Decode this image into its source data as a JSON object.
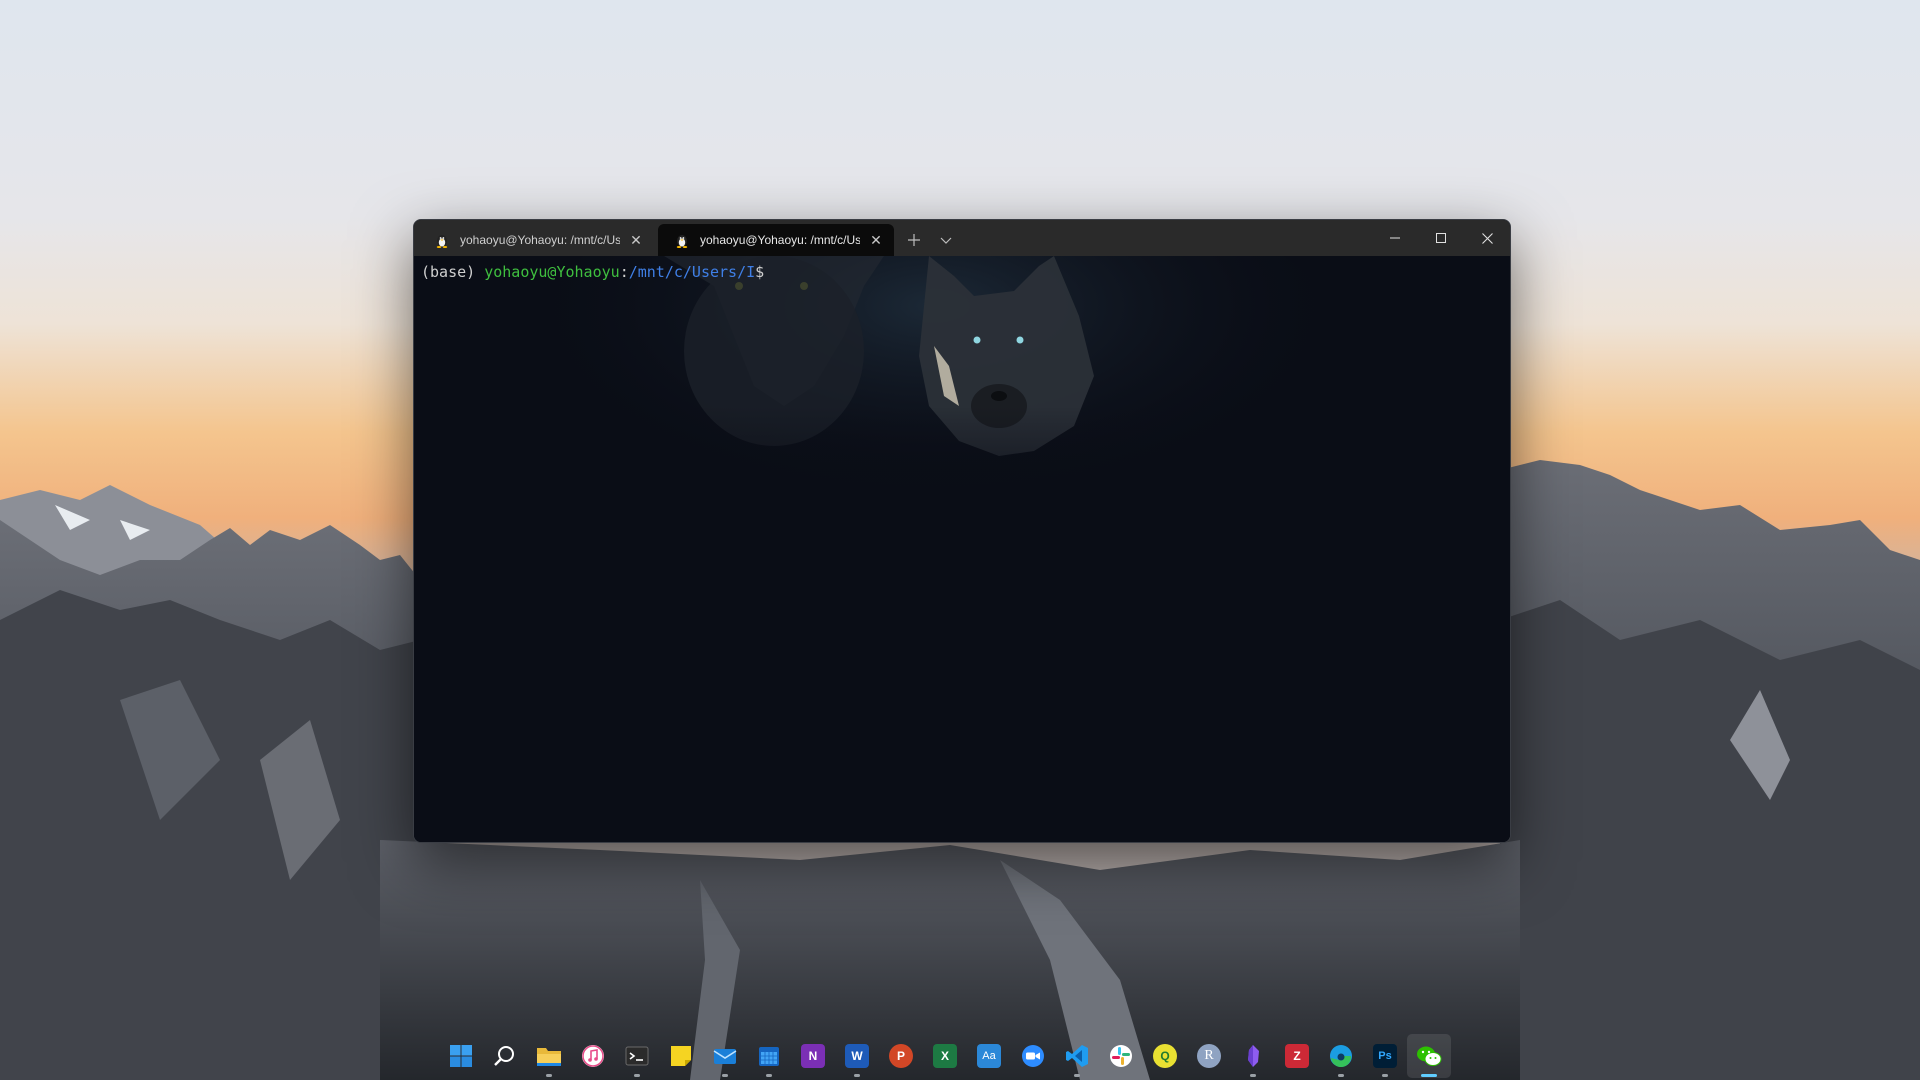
{
  "window": {
    "tabs": [
      {
        "title": "yohaoyu@Yohaoyu: /mnt/c/Use",
        "active": false
      },
      {
        "title": "yohaoyu@Yohaoyu: /mnt/c/Use",
        "active": true
      }
    ],
    "new_tab_icon": "plus-icon",
    "dropdown_icon": "chevron-down-icon",
    "caption_icons": [
      "minimize-icon",
      "maximize-icon",
      "close-icon"
    ]
  },
  "terminal": {
    "env": "(base)",
    "user_host": "yohaoyu@Yohaoyu",
    "colon": ":",
    "path": "/mnt/c/Users/I",
    "symbol": "$",
    "colors": {
      "user": "#3fbf3f",
      "path": "#3f7fe6",
      "background": "#0a0d16"
    }
  },
  "taskbar": {
    "icons": [
      {
        "name": "start",
        "icon": "windows-logo-icon",
        "running": false
      },
      {
        "name": "search",
        "icon": "search-icon",
        "running": false
      },
      {
        "name": "file-explorer",
        "icon": "folder-icon",
        "running": true
      },
      {
        "name": "itunes",
        "icon": "music-note-icon",
        "running": false
      },
      {
        "name": "terminal",
        "icon": "terminal-icon",
        "running": true
      },
      {
        "name": "sticky-notes",
        "icon": "sticky-note-icon",
        "running": false
      },
      {
        "name": "mail",
        "icon": "mail-icon",
        "running": true
      },
      {
        "name": "calendar",
        "icon": "calendar-icon",
        "running": true
      },
      {
        "name": "onenote",
        "icon": "onenote-icon",
        "label": "N",
        "running": false
      },
      {
        "name": "word",
        "icon": "word-icon",
        "label": "W",
        "running": true
      },
      {
        "name": "powerpoint",
        "icon": "powerpoint-icon",
        "label": "P",
        "running": false
      },
      {
        "name": "excel",
        "icon": "excel-icon",
        "label": "X",
        "running": false
      },
      {
        "name": "translator",
        "icon": "translator-icon",
        "label": "Aa",
        "running": false
      },
      {
        "name": "zoom",
        "icon": "video-camera-icon",
        "running": false
      },
      {
        "name": "vscode",
        "icon": "vscode-icon",
        "running": true
      },
      {
        "name": "slack",
        "icon": "slack-icon",
        "running": false
      },
      {
        "name": "qgis",
        "icon": "qgis-icon",
        "label": "Q",
        "running": false
      },
      {
        "name": "r",
        "icon": "r-icon",
        "label": "R",
        "running": false
      },
      {
        "name": "obsidian",
        "icon": "obsidian-icon",
        "running": true
      },
      {
        "name": "zotero",
        "icon": "zotero-icon",
        "label": "Z",
        "running": false
      },
      {
        "name": "edge",
        "icon": "edge-icon",
        "running": true
      },
      {
        "name": "photoshop",
        "icon": "photoshop-icon",
        "label": "Ps",
        "running": true
      },
      {
        "name": "wechat",
        "icon": "wechat-icon",
        "running": true,
        "active": true
      }
    ]
  }
}
